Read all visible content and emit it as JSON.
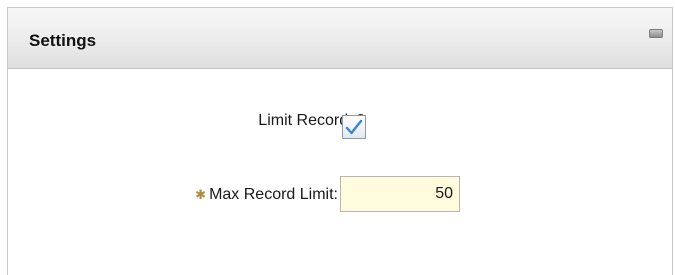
{
  "panel": {
    "title": "Settings",
    "collapse_icon": "minimize-icon"
  },
  "form": {
    "limit_records": {
      "label": "Limit Records?",
      "checked": true,
      "check_icon": "checkmark-icon"
    },
    "max_record_limit": {
      "required_marker": "✱",
      "label": "Max Record Limit:",
      "value": "50"
    }
  },
  "colors": {
    "input_background": "#fffbdc",
    "check_color": "#3a87d6",
    "required_star": "#b18a3b"
  }
}
